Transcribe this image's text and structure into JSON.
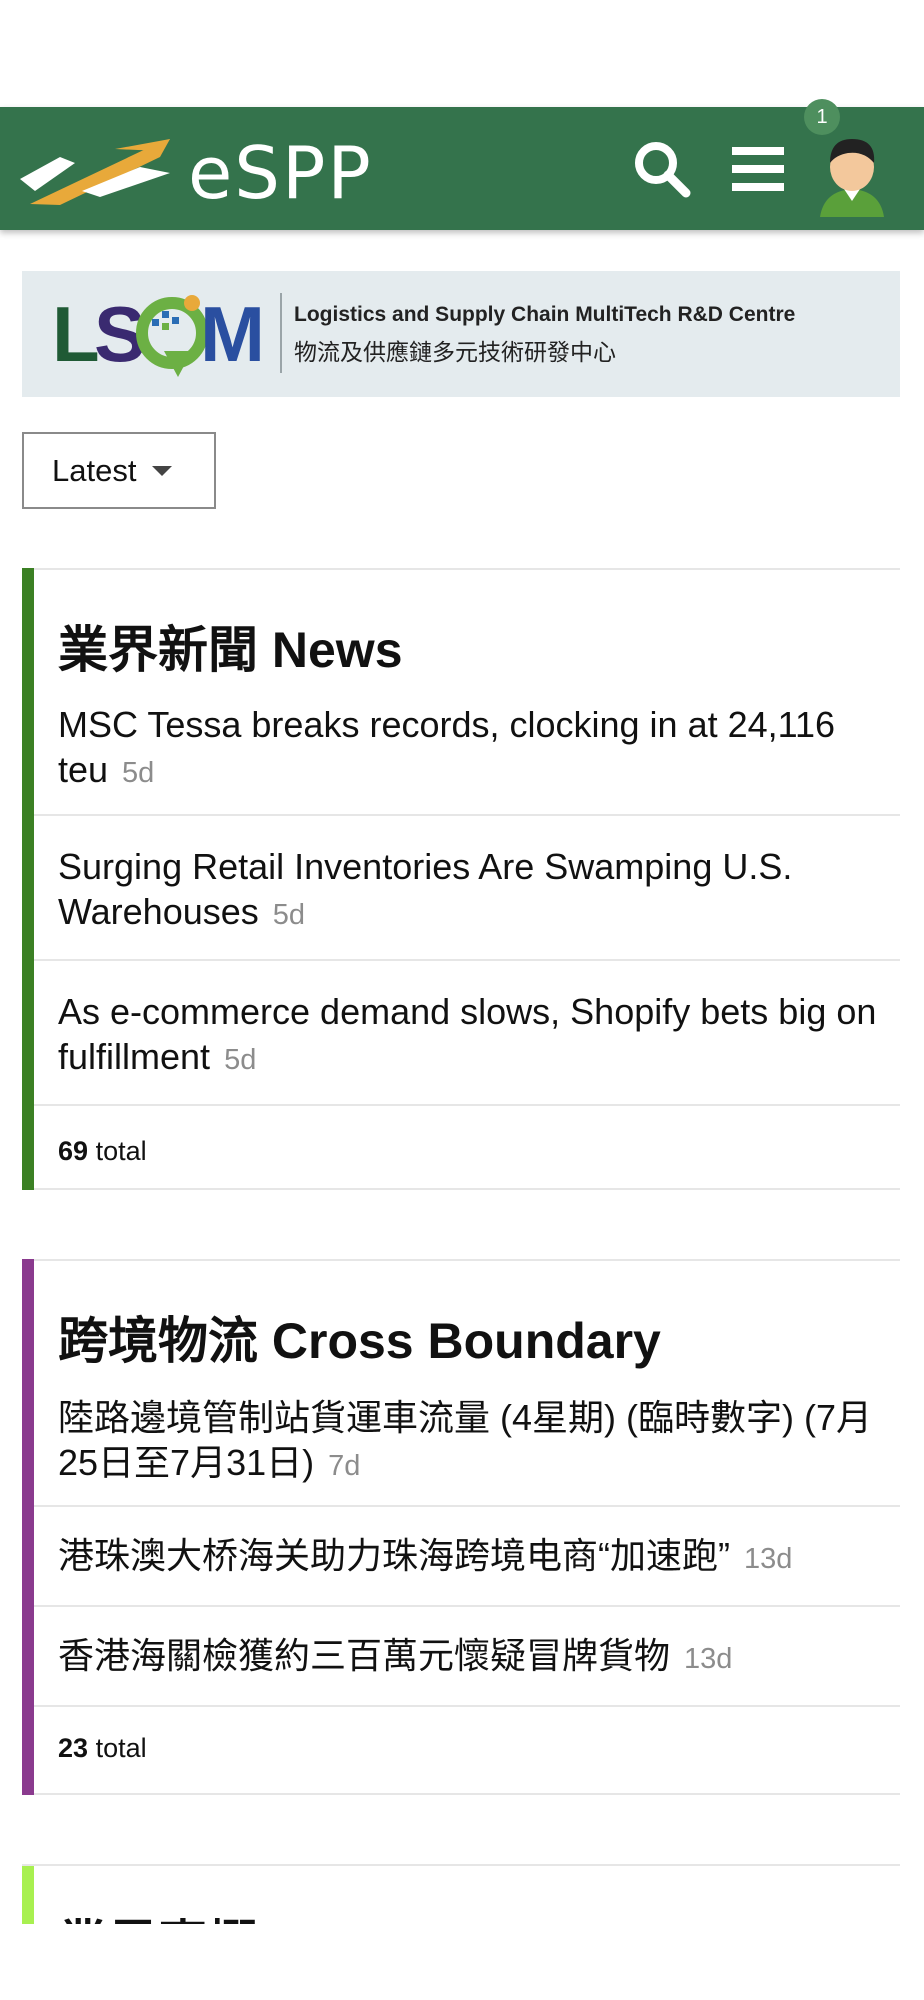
{
  "header": {
    "app_name": "eSPP",
    "notification_count": "1",
    "bg_color": "#34734c"
  },
  "banner": {
    "logo_text": "LSCM",
    "title_en": "Logistics and Supply Chain MultiTech R&D Centre",
    "title_zh": "物流及供應鏈多元技術研發中心"
  },
  "filter": {
    "selected": "Latest"
  },
  "categories": [
    {
      "title": "業界新聞 News",
      "color": "#3b8024",
      "topics": [
        {
          "title": "MSC Tessa breaks records, clocking in at 24,116 teu",
          "age": "5d"
        },
        {
          "title": "Surging Retail Inventories Are Swamping U.S. Warehouses",
          "age": "5d"
        },
        {
          "title": "As e-commerce demand slows, Shopify bets big on fulfillment",
          "age": "5d"
        }
      ],
      "total_count": "69",
      "total_label": "total"
    },
    {
      "title": "跨境物流 Cross Boundary",
      "color": "#8a3a8e",
      "topics": [
        {
          "title": "陸路邊境管制站貨運車流量 (4星期) (臨時數字) (7月25日至7月31日)",
          "age": "7d"
        },
        {
          "title": "港珠澳大桥海关助力珠海跨境电商“加速跑”",
          "age": "13d"
        },
        {
          "title": "香港海關檢獲約三百萬元懷疑冒牌貨物",
          "age": "13d"
        }
      ],
      "total_count": "23",
      "total_label": "total"
    },
    {
      "title": "業界專欄 Col",
      "color": "#a8f050"
    }
  ]
}
